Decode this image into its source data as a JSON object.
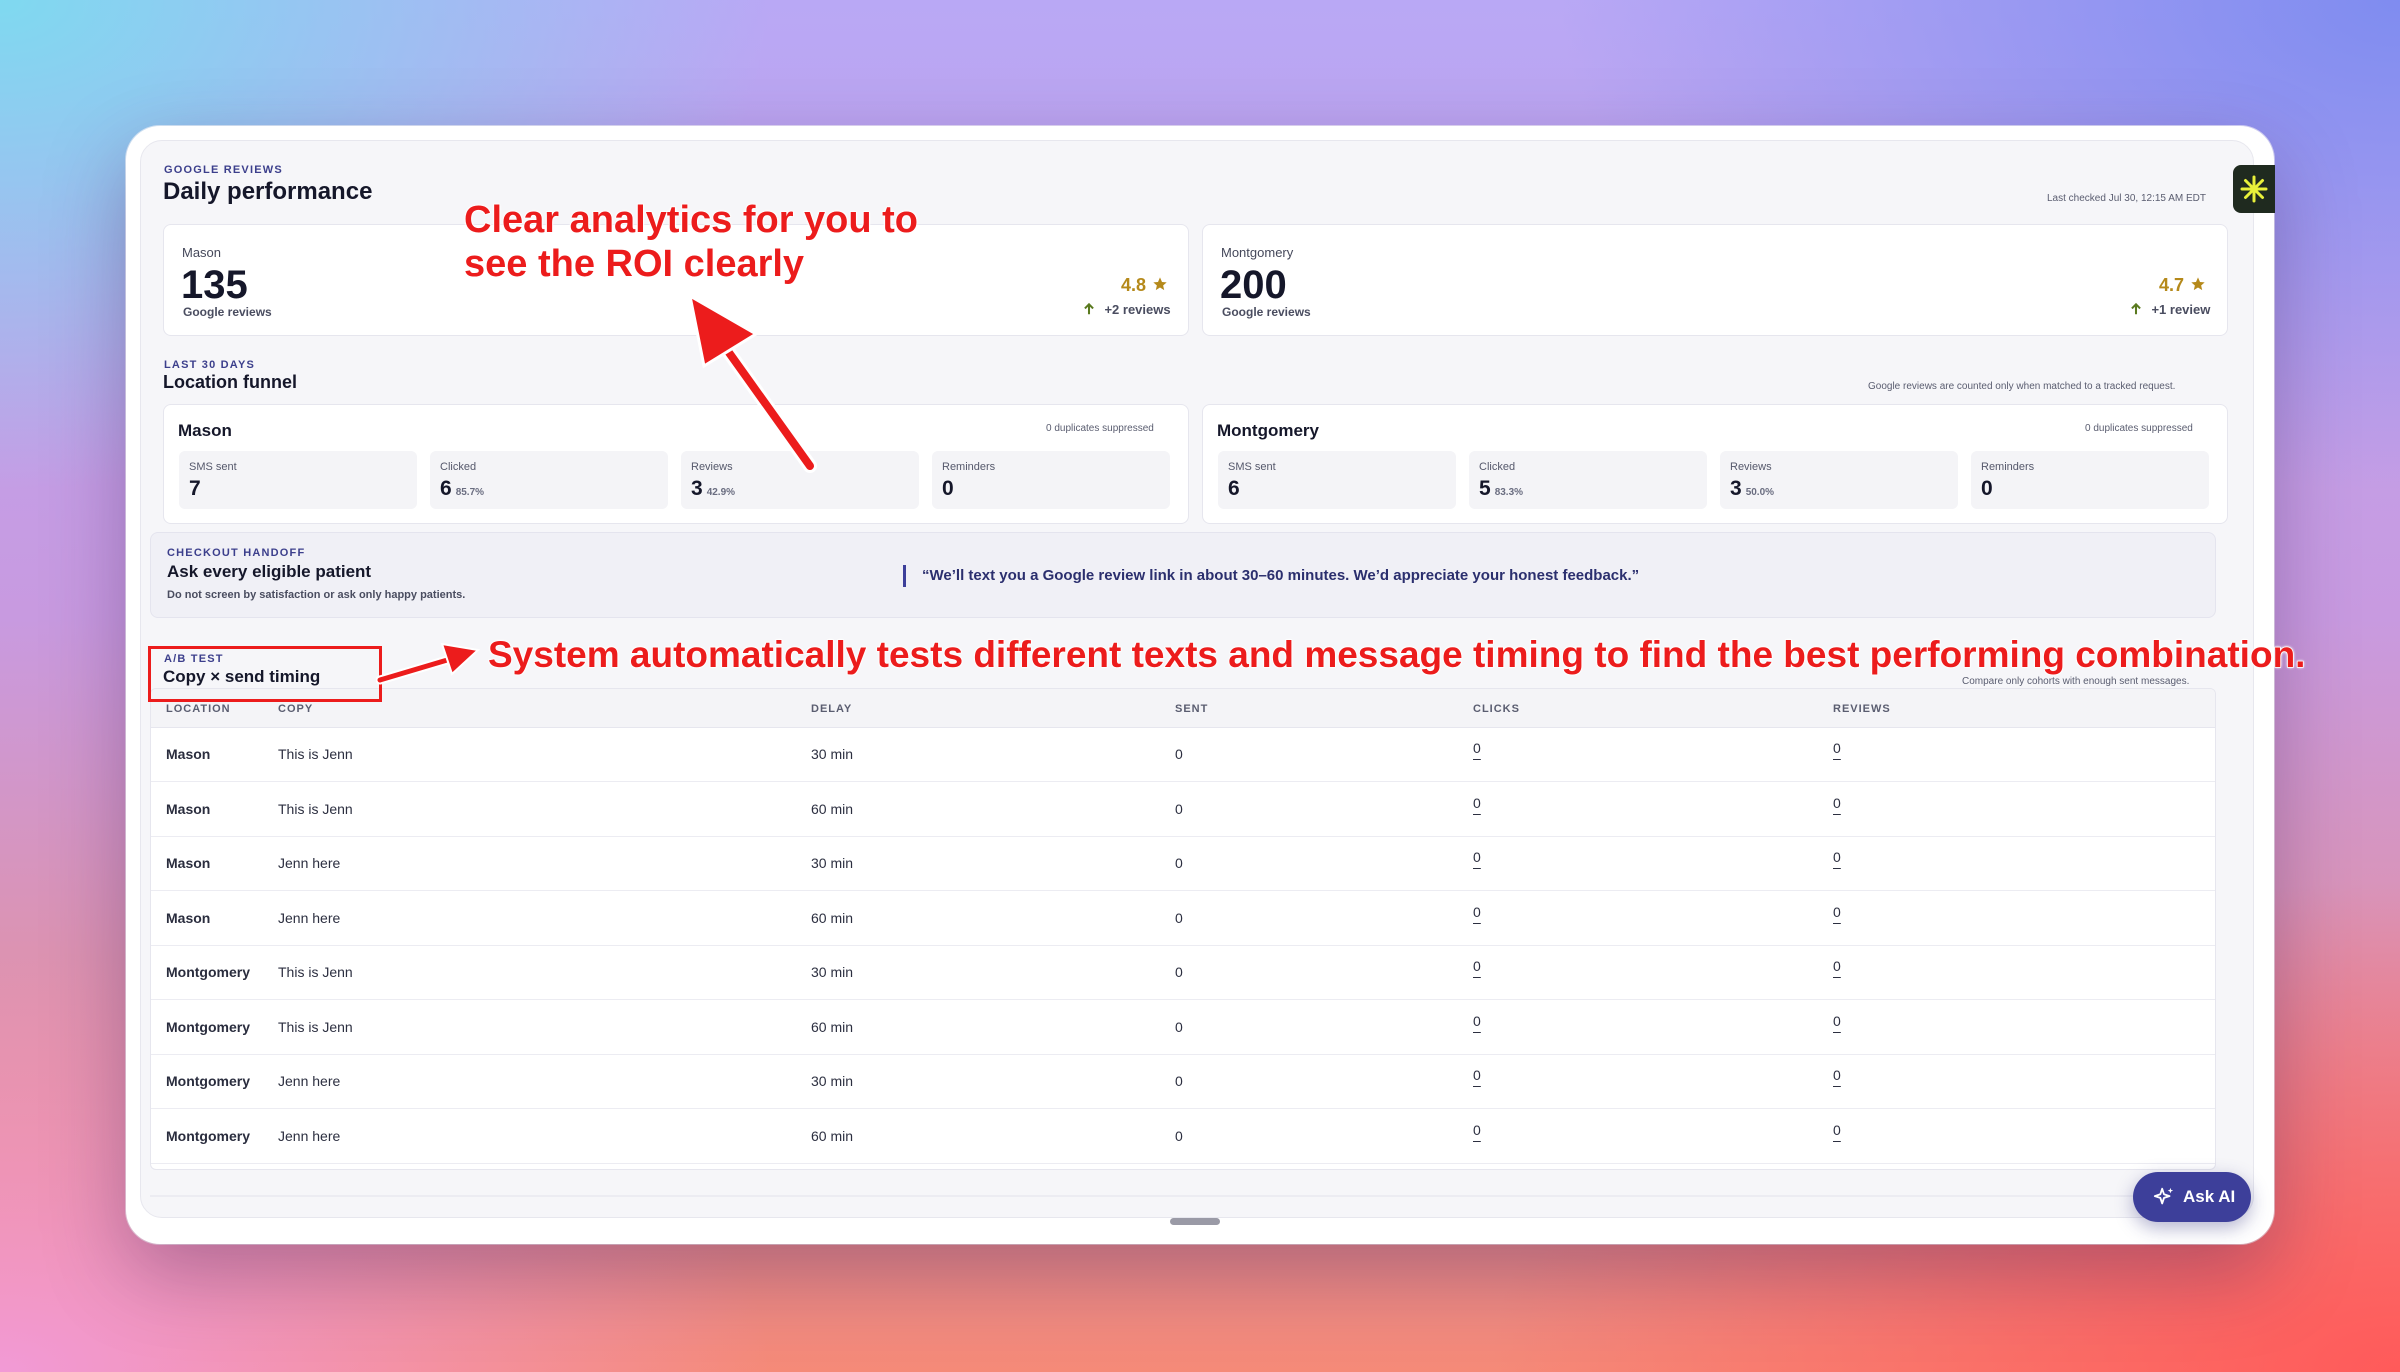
{
  "header": {
    "eyebrow": "GOOGLE REVIEWS",
    "title": "Daily performance",
    "last_checked": "Last checked Jul 30, 12:15 AM EDT"
  },
  "review_cards": [
    {
      "location": "Mason",
      "count": "135",
      "count_label": "Google reviews",
      "rating": "4.8",
      "delta": "+2 reviews"
    },
    {
      "location": "Montgomery",
      "count": "200",
      "count_label": "Google reviews",
      "rating": "4.7",
      "delta": "+1 review"
    }
  ],
  "funnel": {
    "eyebrow": "LAST 30 DAYS",
    "title": "Location funnel",
    "note": "Google reviews are counted only when matched to a tracked request.",
    "locations": [
      {
        "name": "Mason",
        "duplicates": "0 duplicates suppressed",
        "metrics": [
          {
            "label": "SMS sent",
            "value": "7",
            "pct": ""
          },
          {
            "label": "Clicked",
            "value": "6",
            "pct": "85.7%"
          },
          {
            "label": "Reviews",
            "value": "3",
            "pct": "42.9%"
          },
          {
            "label": "Reminders",
            "value": "0",
            "pct": ""
          }
        ]
      },
      {
        "name": "Montgomery",
        "duplicates": "0 duplicates suppressed",
        "metrics": [
          {
            "label": "SMS sent",
            "value": "6",
            "pct": ""
          },
          {
            "label": "Clicked",
            "value": "5",
            "pct": "83.3%"
          },
          {
            "label": "Reviews",
            "value": "3",
            "pct": "50.0%"
          },
          {
            "label": "Reminders",
            "value": "0",
            "pct": ""
          }
        ]
      }
    ]
  },
  "handoff": {
    "eyebrow": "CHECKOUT HANDOFF",
    "title": "Ask every eligible patient",
    "subtitle": "Do not screen by satisfaction or ask only happy patients.",
    "quote": "“We’ll text you a Google review link in about 30–60 minutes. We’d appreciate your honest feedback.”"
  },
  "ab_test": {
    "eyebrow": "A/B TEST",
    "title": "Copy × send timing",
    "note": "Compare only cohorts with enough sent messages.",
    "columns": [
      "LOCATION",
      "COPY",
      "DELAY",
      "SENT",
      "CLICKS",
      "REVIEWS"
    ],
    "rows": [
      {
        "location": "Mason",
        "copy": "This is Jenn",
        "delay": "30 min",
        "sent": "0",
        "clicks": "0",
        "reviews": "0"
      },
      {
        "location": "Mason",
        "copy": "This is Jenn",
        "delay": "60 min",
        "sent": "0",
        "clicks": "0",
        "reviews": "0"
      },
      {
        "location": "Mason",
        "copy": "Jenn here",
        "delay": "30 min",
        "sent": "0",
        "clicks": "0",
        "reviews": "0"
      },
      {
        "location": "Mason",
        "copy": "Jenn here",
        "delay": "60 min",
        "sent": "0",
        "clicks": "0",
        "reviews": "0"
      },
      {
        "location": "Montgomery",
        "copy": "This is Jenn",
        "delay": "30 min",
        "sent": "0",
        "clicks": "0",
        "reviews": "0"
      },
      {
        "location": "Montgomery",
        "copy": "This is Jenn",
        "delay": "60 min",
        "sent": "0",
        "clicks": "0",
        "reviews": "0"
      },
      {
        "location": "Montgomery",
        "copy": "Jenn here",
        "delay": "30 min",
        "sent": "0",
        "clicks": "0",
        "reviews": "0"
      },
      {
        "location": "Montgomery",
        "copy": "Jenn here",
        "delay": "60 min",
        "sent": "0",
        "clicks": "0",
        "reviews": "0"
      }
    ]
  },
  "annotations": {
    "roi_line1": "Clear analytics for you to",
    "roi_line2": "see the ROI clearly",
    "ab_callout": "System automatically tests different texts and message timing to find the best performing combination."
  },
  "ask_ai": {
    "label": "Ask AI"
  },
  "icons": {
    "rating": "star-icon",
    "delta": "arrow-up-icon",
    "ask_ai": "sparkle-icon",
    "brand": "asterisk-logo-icon"
  },
  "colors": {
    "accent": "#3d3f9a",
    "rating": "#b5891a",
    "delta_up": "#5a7a1f",
    "annotation": "#ec1c1c",
    "brand_badge": "#1f2a1f",
    "brand_mark": "#e8f03a"
  }
}
